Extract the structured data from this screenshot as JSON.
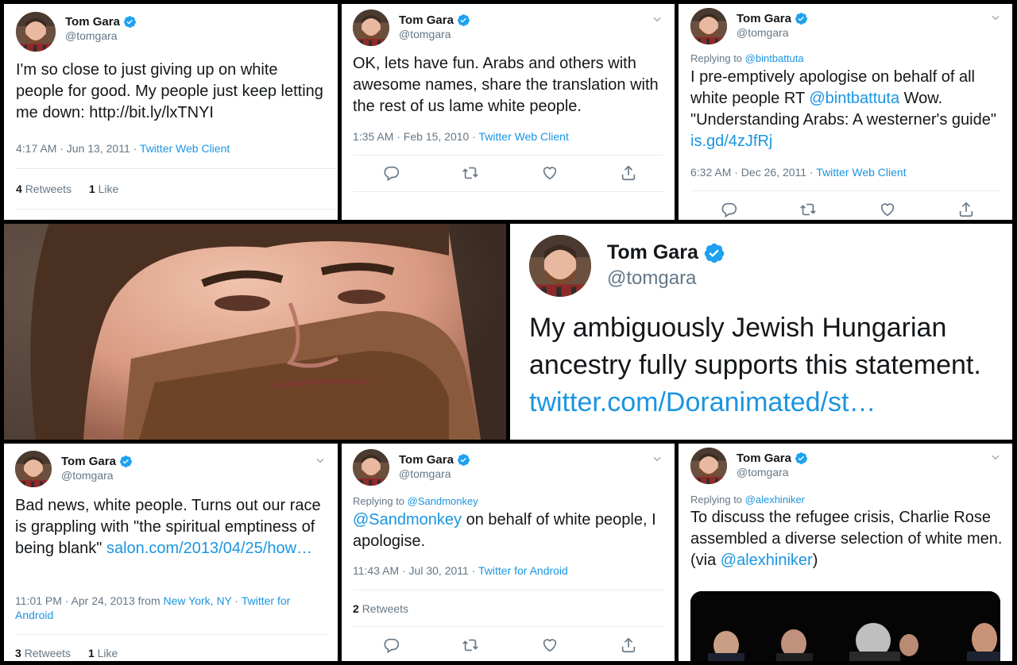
{
  "user": {
    "name": "Tom Gara",
    "handle": "@tomgara"
  },
  "tweets": {
    "t1": {
      "text": "I'm so close to just giving up on white people for good. My people just keep letting me down: http://bit.ly/lxTNYI",
      "time": "4:17 AM · Jun 13, 2011 · ",
      "client": "Twitter Web Client",
      "retweets_count": "4",
      "retweets_label": "Retweets",
      "likes_count": "1",
      "likes_label": "Like"
    },
    "t2": {
      "text": "OK, lets have fun. Arabs and others with awesome names, share the translation with the rest of us lame white people.",
      "time": "1:35 AM · Feb 15, 2010 · ",
      "client": "Twitter Web Client"
    },
    "t3": {
      "replying_prefix": "Replying to ",
      "replying_to": "@bintbattuta",
      "text_a": "I pre-emptively apologise on behalf of all white people RT ",
      "mention": "@bintbattuta",
      "text_b": " Wow. \"Understanding Arabs: A westerner's guide\" ",
      "link": "is.gd/4zJfRj",
      "time": "6:32 AM · Dec 26, 2011 · ",
      "client": "Twitter Web Client"
    },
    "t4": {
      "text": "My ambiguously Jewish Hungarian ancestry fully supports this statement.",
      "link": "twitter.com/Doranimated/st…"
    },
    "t5": {
      "text": "Bad news, white people. Turns out our race is grappling with \"the spiritual emptiness of being blank\"",
      "link": "salon.com/2013/04/25/how…",
      "time": "11:01 PM · Apr 24, 2013 from ",
      "location": "New York, NY",
      "sep": " · ",
      "client": "Twitter for Android",
      "retweets_count": "3",
      "retweets_label": "Retweets",
      "likes_count": "1",
      "likes_label": "Like"
    },
    "t6": {
      "replying_prefix": "Replying to ",
      "replying_to": "@Sandmonkey",
      "mention": "@Sandmonkey",
      "text": " on behalf of white people, I apologise.",
      "time": "11:43 AM · Jul 30, 2011 · ",
      "client": "Twitter for Android",
      "retweets_count": "2",
      "retweets_label": "Retweets"
    },
    "t7": {
      "replying_prefix": "Replying to ",
      "replying_to": "@alexhiniker",
      "text": "To discuss the refugee crisis, Charlie Rose assembled a diverse selection of white men. (via ",
      "mention": "@alexhiniker",
      "text_end": ")"
    }
  },
  "icons": [
    "verified-badge-icon",
    "chevron-down-icon",
    "reply-icon",
    "retweet-icon",
    "like-icon",
    "share-icon"
  ],
  "colors": {
    "link": "#1b95e0",
    "verified": "#1da1f2",
    "meta": "#657786",
    "text": "#14171a"
  }
}
